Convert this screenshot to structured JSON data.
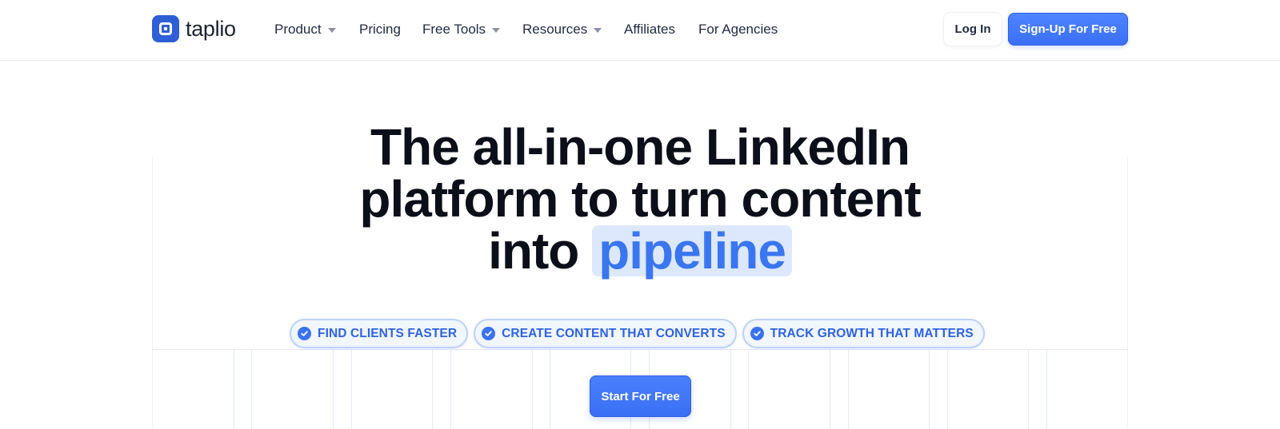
{
  "brand": {
    "logo_text": "taplio",
    "logo_icon": "taplio-logo-icon"
  },
  "nav": {
    "product": "Product",
    "pricing": "Pricing",
    "free_tools": "Free Tools",
    "resources": "Resources",
    "affiliates": "Affiliates",
    "agencies": "For Agencies"
  },
  "header_actions": {
    "login": "Log In",
    "signup": "Sign-Up For Free"
  },
  "hero": {
    "line1": "The all-in-one LinkedIn",
    "line2": "platform to turn content",
    "line3_prefix": "into",
    "highlight": "pipeline"
  },
  "pills": [
    {
      "label": "FIND CLIENTS FASTER",
      "icon": "check-circle-icon"
    },
    {
      "label": "CREATE CONTENT THAT CONVERTS",
      "icon": "check-circle-icon"
    },
    {
      "label": "TRACK GROWTH THAT MATTERS",
      "icon": "check-circle-icon"
    }
  ],
  "cta": {
    "start": "Start For Free"
  },
  "colors": {
    "brand_blue": "#2f5fd6",
    "accent_blue": "#3a72f2",
    "highlight_bg": "#dde8fd"
  }
}
